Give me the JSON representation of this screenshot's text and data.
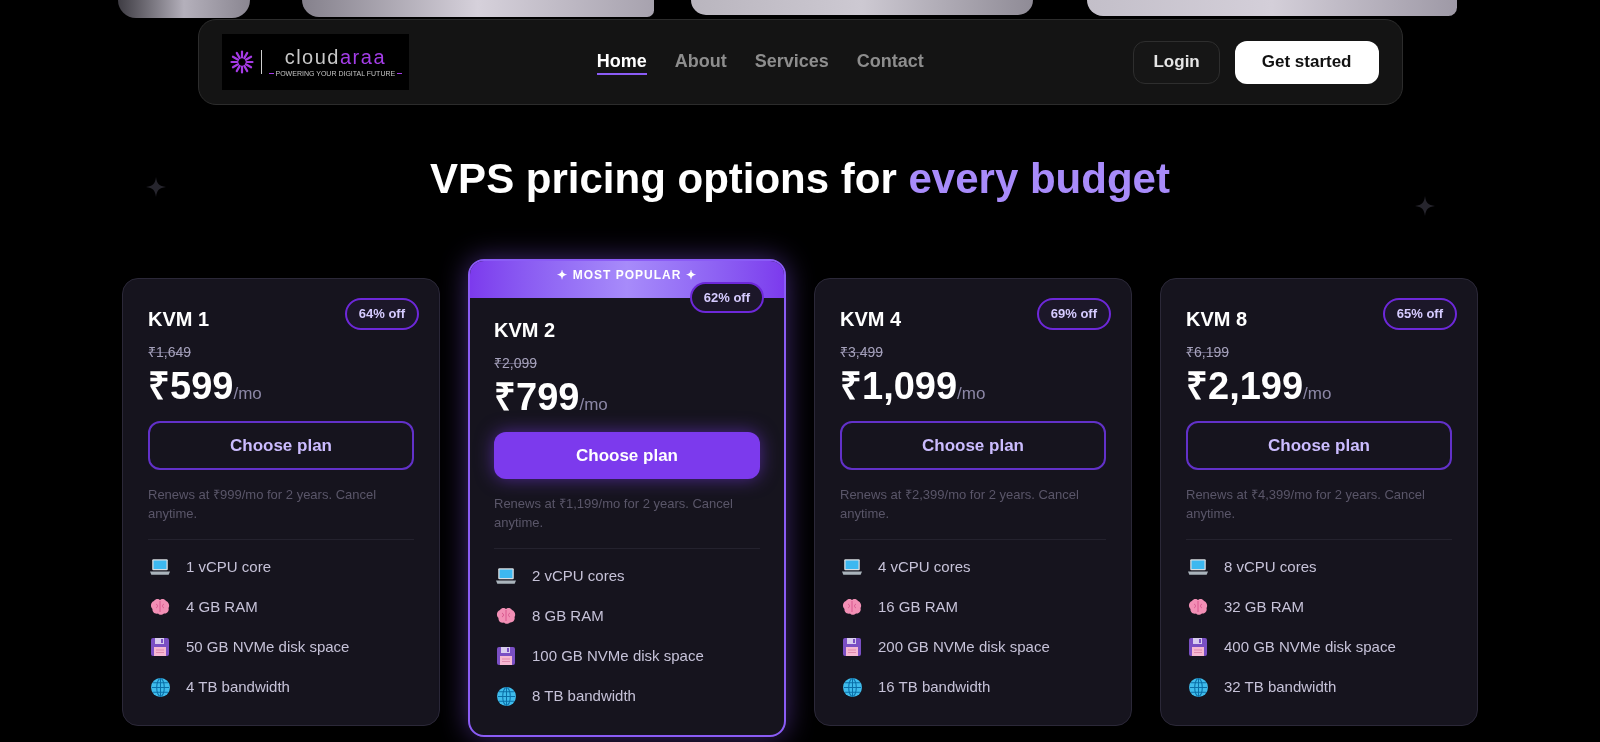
{
  "navbar": {
    "logo": {
      "wordmark_main": "cloud",
      "wordmark_accent": "araa",
      "tagline": "POWERING YOUR DIGITAL FUTURE"
    },
    "links": [
      {
        "label": "Home",
        "selected": true
      },
      {
        "label": "About",
        "selected": false
      },
      {
        "label": "Services",
        "selected": false
      },
      {
        "label": "Contact",
        "selected": false
      }
    ],
    "login_button": "Login",
    "cta_button": "Get started"
  },
  "heading": {
    "text": "VPS pricing options for",
    "accent": "every budget"
  },
  "plans": [
    {
      "name": "KVM 1",
      "popular": false,
      "discount": "64% off",
      "original_price": "₹1,649",
      "price": "₹599",
      "period": "/mo",
      "button": "Choose plan",
      "renewal": "Renews at ₹999/mo for 2 years. Cancel anytime.",
      "features": [
        {
          "kind": "cpu",
          "text": "1 vCPU core"
        },
        {
          "kind": "ram",
          "text": "4 GB RAM"
        },
        {
          "kind": "storage",
          "text": "50 GB NVMe disk space"
        },
        {
          "kind": "bandwidth",
          "text": "4 TB bandwidth"
        }
      ]
    },
    {
      "name": "KVM 2",
      "popular": true,
      "popular_label": "✦ MOST POPULAR ✦",
      "discount": "62% off",
      "original_price": "₹2,099",
      "price": "₹799",
      "period": "/mo",
      "button": "Choose plan",
      "renewal": "Renews at ₹1,199/mo for 2 years. Cancel anytime.",
      "features": [
        {
          "kind": "cpu",
          "text": "2 vCPU cores"
        },
        {
          "kind": "ram",
          "text": "8 GB RAM"
        },
        {
          "kind": "storage",
          "text": "100 GB NVMe disk space"
        },
        {
          "kind": "bandwidth",
          "text": "8 TB bandwidth"
        }
      ]
    },
    {
      "name": "KVM 4",
      "popular": false,
      "discount": "69% off",
      "original_price": "₹3,499",
      "price": "₹1,099",
      "period": "/mo",
      "button": "Choose plan",
      "renewal": "Renews at ₹2,399/mo for 2 years. Cancel anytime.",
      "features": [
        {
          "kind": "cpu",
          "text": "4 vCPU cores"
        },
        {
          "kind": "ram",
          "text": "16 GB RAM"
        },
        {
          "kind": "storage",
          "text": "200 GB NVMe disk space"
        },
        {
          "kind": "bandwidth",
          "text": "16 TB bandwidth"
        }
      ]
    },
    {
      "name": "KVM 8",
      "popular": false,
      "discount": "65% off",
      "original_price": "₹6,199",
      "price": "₹2,199",
      "period": "/mo",
      "button": "Choose plan",
      "renewal": "Renews at ₹4,399/mo for 2 years. Cancel anytime.",
      "features": [
        {
          "kind": "cpu",
          "text": "8 vCPU cores"
        },
        {
          "kind": "ram",
          "text": "32 GB RAM"
        },
        {
          "kind": "storage",
          "text": "400 GB NVMe disk space"
        },
        {
          "kind": "bandwidth",
          "text": "32 TB bandwidth"
        }
      ]
    }
  ]
}
